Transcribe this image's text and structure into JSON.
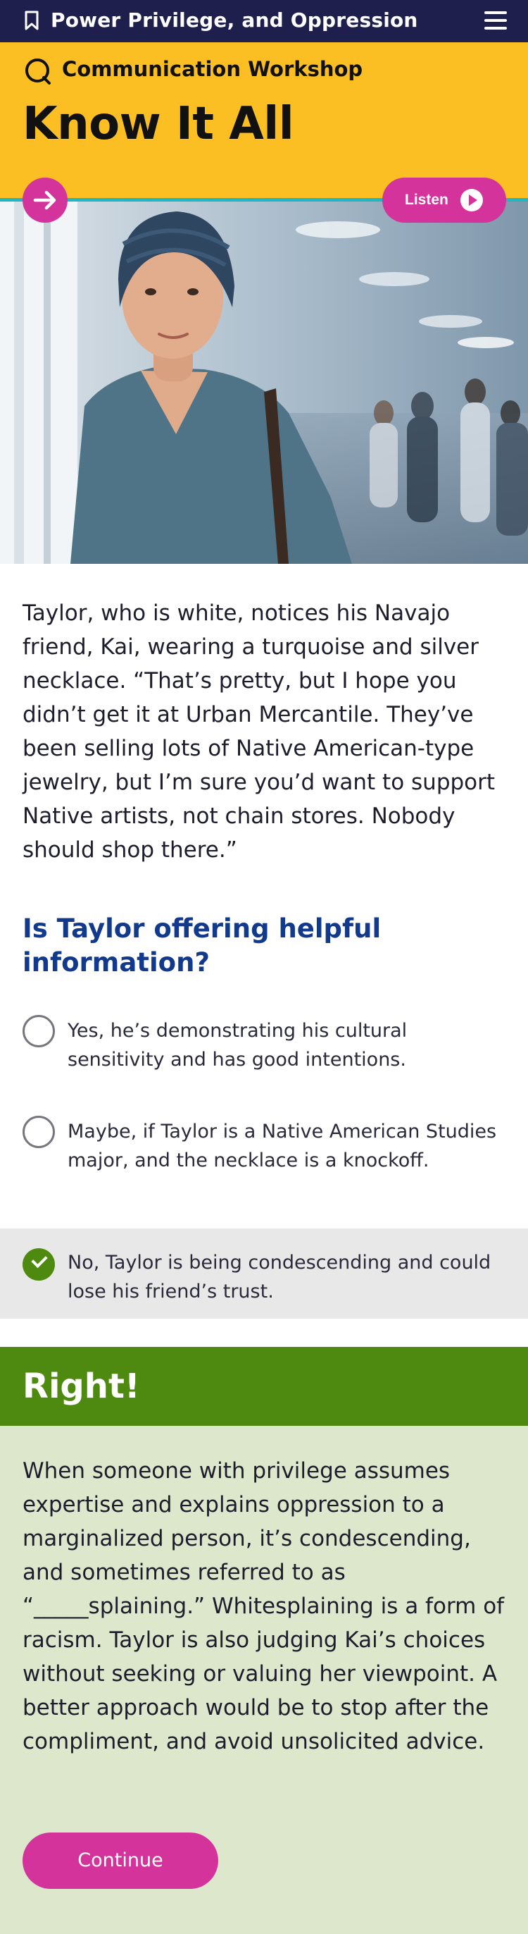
{
  "header": {
    "title": "Power Privilege, and Oppression",
    "bookmark_icon": "bookmark-icon",
    "menu_icon": "hamburger-menu-icon"
  },
  "hero": {
    "kicker": "Communication Workshop",
    "kicker_icon": "speech-bubble-icon",
    "headline": "Know It All",
    "listen_label": "Listen",
    "next_icon": "arrow-right-icon",
    "play_icon": "play-icon"
  },
  "scenario": {
    "text": "Taylor, who is white, notices his Navajo friend, Kai, wearing a turquoise and silver necklace. “That’s pretty, but I hope you didn’t get it at Urban Mercantile. They’ve been selling lots of Native American-type jewelry, but I’m sure you’d want to support Native artists, not chain stores. Nobody should shop there.”"
  },
  "question": {
    "text": "Is Taylor offering helpful information?",
    "options": [
      {
        "text": "Yes, he’s demonstrating his cultural sensitivity and has good intentions.",
        "selected": false
      },
      {
        "text": "Maybe, if Taylor is a Native American Studies major, and the necklace is a knockoff.",
        "selected": false
      },
      {
        "text": "No, Taylor is being condescending and could lose his friend’s trust.",
        "selected": true
      }
    ]
  },
  "feedback": {
    "heading": "Right!",
    "text": "When someone with privilege assumes expertise and explains oppression to a marginalized person, it’s condescending, and sometimes referred to as “_____splaining.” Whitesplaining is a form of racism. Taylor is also judging Kai’s choices without seeking or valuing her viewpoint. A better approach would be to stop after the compliment, and avoid unsolicited advice.",
    "continue_label": "Continue"
  },
  "colors": {
    "header_bg": "#1f1f4d",
    "hero_bg": "#fbbf24",
    "accent_teal": "#21b7c2",
    "button_magenta": "#d3339a",
    "question_blue": "#123a8c",
    "success_green": "#4d8a0f",
    "feedback_bg": "#dce7cc"
  }
}
